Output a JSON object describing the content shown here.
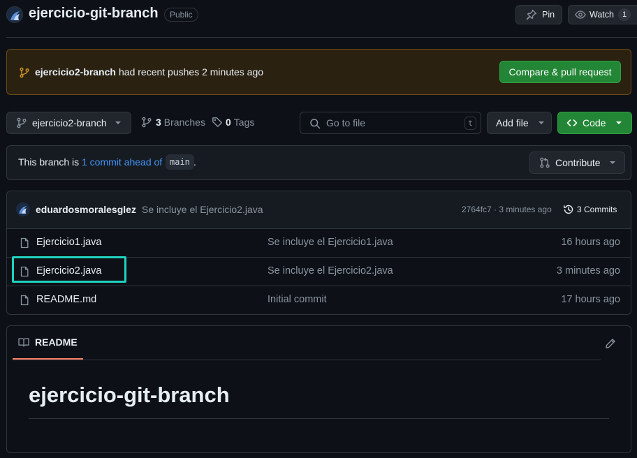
{
  "repo": {
    "name": "ejercicio-git-branch",
    "visibility": "Public",
    "pin_label": "Pin",
    "watch_label": "Watch",
    "watch_count": "1"
  },
  "push_banner": {
    "branch": "ejercicio2-branch",
    "text": "had recent pushes 2 minutes ago",
    "button": "Compare & pull request"
  },
  "toolbar": {
    "branch_selector": "ejercicio2-branch",
    "branches_count": "3",
    "branches_label": "Branches",
    "tags_count": "0",
    "tags_label": "Tags",
    "search_placeholder": "Go to file",
    "search_shortcut": "t",
    "add_file_label": "Add file",
    "code_label": "Code"
  },
  "ahead_box": {
    "prefix": "This branch is",
    "link": "1 commit ahead of",
    "base_branch": "main",
    "suffix": ".",
    "contribute_label": "Contribute"
  },
  "latest_commit": {
    "author": "eduardosmoralesglez",
    "message": "Se incluye el Ejercicio2.java",
    "meta": "2764fc7 · 3 minutes ago",
    "commits_label": "3 Commits"
  },
  "files": [
    {
      "name": "Ejercicio1.java",
      "message": "Se incluye el Ejercicio1.java",
      "time": "16 hours ago"
    },
    {
      "name": "Ejercicio2.java",
      "message": "Se incluye el Ejercicio2.java",
      "time": "3 minutes ago"
    },
    {
      "name": "README.md",
      "message": "Initial commit",
      "time": "17 hours ago"
    }
  ],
  "readme": {
    "tab_label": "README",
    "heading": "ejercicio-git-branch"
  },
  "colors": {
    "background": "#0d1117",
    "border": "#30363d",
    "green_button": "#238636",
    "link": "#4493f8",
    "highlight": "#1fd1c0",
    "banner_bg": "#2b2111",
    "banner_border": "#6b4a17",
    "tab_underline": "#f78166"
  }
}
